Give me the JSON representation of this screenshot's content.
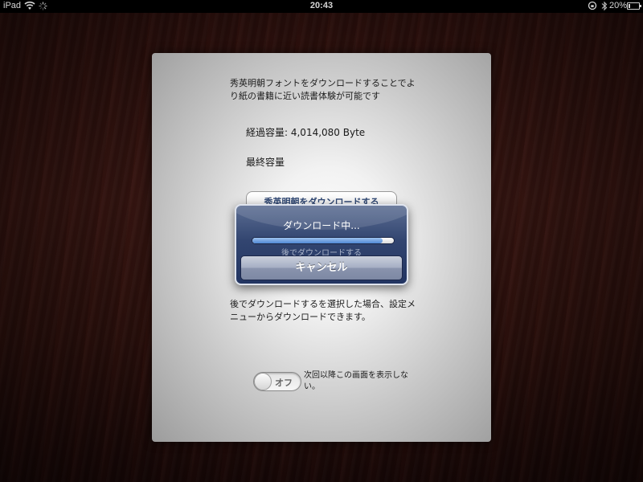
{
  "status_bar": {
    "device": "iPad",
    "time": "20:43",
    "battery_percent": "20%",
    "battery_level": 0.2,
    "icons": [
      "wifi-icon",
      "activity-spinner-icon",
      "orientation-lock-icon",
      "bluetooth-icon",
      "battery-icon"
    ]
  },
  "panel": {
    "description": "秀英明朝フォントをダウンロードすることでより紙の書籍に近い読書体験が可能です",
    "progress_label": "経過容量: 4,014,080 Byte",
    "final_label": "最終容量",
    "download_button": "秀英明朝をダウンロードする",
    "later_button": "後でダウンロードする",
    "note": "後でダウンロードするを選択した場合、設定メニューからダウンロードできます。",
    "toggle_state": "オフ",
    "toggle_label": "次回以降この画面を表示しない。"
  },
  "alert": {
    "title": "ダウンロード中...",
    "progress": 0.92,
    "cancel_button": "キャンセル"
  },
  "colors": {
    "alert_blue": "#2b3d68",
    "button_text": "#2f4773",
    "progress_fill": "#5a93d9"
  }
}
